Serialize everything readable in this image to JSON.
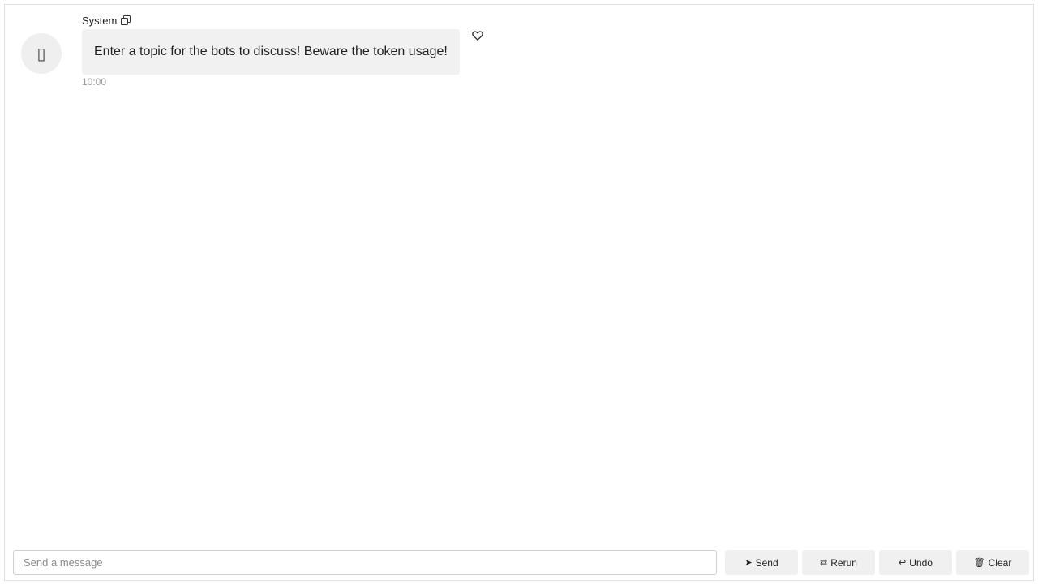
{
  "message": {
    "sender": "System",
    "avatar_icon": "robot-icon",
    "avatar_glyph": "▯",
    "text": "Enter a topic for the bots to discuss! Beware the token usage!",
    "time": "10:00"
  },
  "composer": {
    "placeholder": "Send a message"
  },
  "actions": {
    "send_label": "Send",
    "send_icon": "➤",
    "rerun_label": "Rerun",
    "rerun_icon": "⇄",
    "undo_label": "Undo",
    "undo_icon": "↩",
    "clear_label": "Clear",
    "clear_icon": "🗑"
  }
}
